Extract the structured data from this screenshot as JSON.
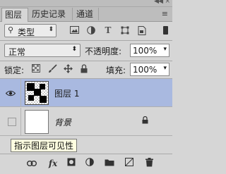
{
  "tabs": [
    {
      "label": "图层",
      "close": "×"
    },
    {
      "label": "历史记录"
    },
    {
      "label": "通道"
    }
  ],
  "header": {
    "collapse": "◀◀",
    "close": "×",
    "menu": "≡"
  },
  "filter": {
    "kind_label": "类型",
    "icons": [
      "image-filter-icon",
      "adjustment-filter-icon",
      "text-filter-icon",
      "shape-filter-icon",
      "smart-object-filter-icon"
    ]
  },
  "blend": {
    "mode": "正常",
    "opacity_label": "不透明度:",
    "opacity_value": "100%"
  },
  "lock": {
    "label": "锁定:",
    "fill_label": "填充:",
    "fill_value": "100%"
  },
  "layers": [
    {
      "name": "图层 1",
      "visible": true,
      "selected": true
    },
    {
      "name": "背景",
      "visible": false,
      "selected": false,
      "locked": true
    }
  ],
  "tooltip": "指示图层可见性",
  "bottom_icons": [
    "link-icon",
    "fx-icon",
    "mask-icon",
    "adjustment-icon",
    "folder-icon",
    "new-layer-icon",
    "trash-icon"
  ]
}
